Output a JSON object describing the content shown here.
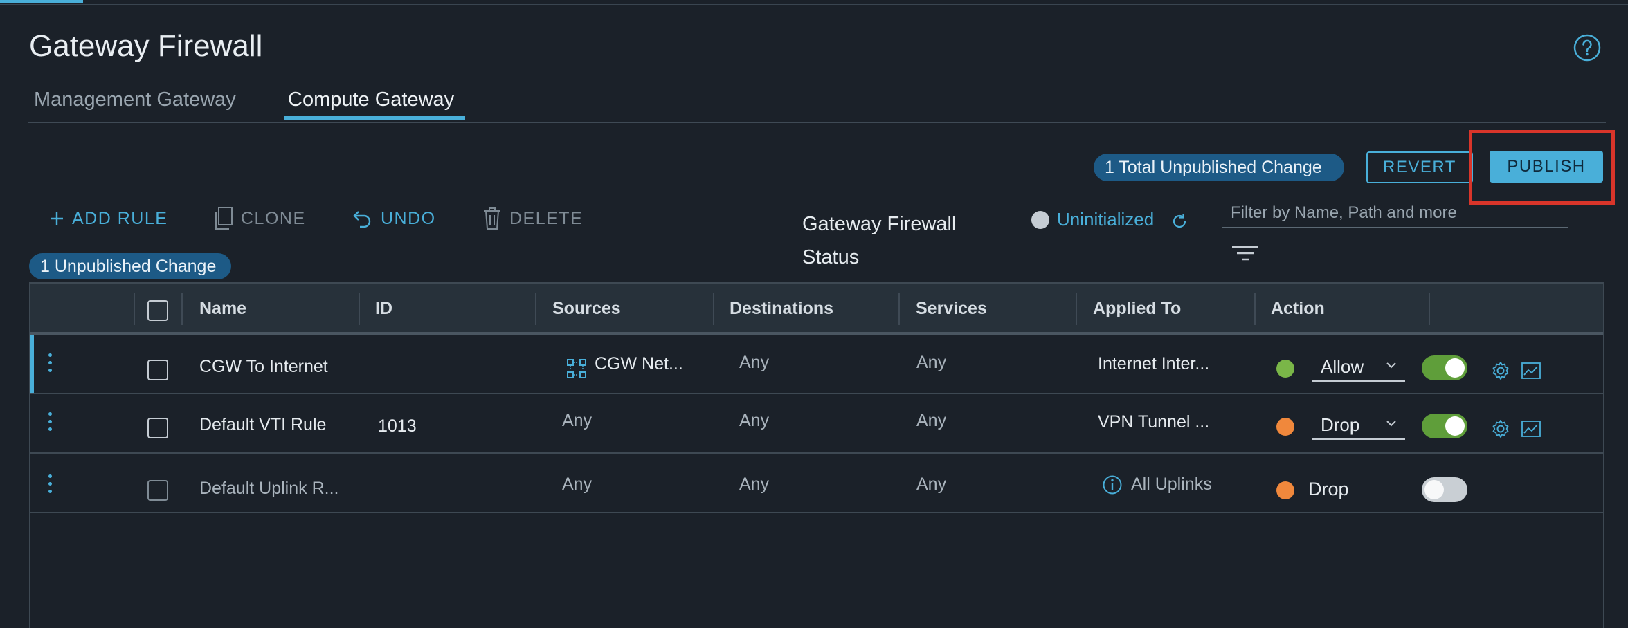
{
  "page": {
    "title": "Gateway Firewall"
  },
  "tabs": [
    {
      "label": "Management Gateway",
      "active": false
    },
    {
      "label": "Compute Gateway",
      "active": true
    }
  ],
  "header_actions": {
    "total_unpublished": "1 Total Unpublished Change",
    "revert": "REVERT",
    "publish": "PUBLISH"
  },
  "toolbar": {
    "add_rule": "ADD RULE",
    "clone": "CLONE",
    "undo": "UNDO",
    "delete": "DELETE"
  },
  "status": {
    "label": "Gateway Firewall Status",
    "value": "Uninitialized"
  },
  "filter": {
    "placeholder": "Filter by Name, Path and more"
  },
  "unpublished_badge": "1 Unpublished Change",
  "table": {
    "columns": [
      "Name",
      "ID",
      "Sources",
      "Destinations",
      "Services",
      "Applied To",
      "Action"
    ],
    "rows": [
      {
        "name": "CGW To Internet",
        "id": "",
        "sources": "CGW Net...",
        "destinations": "Any",
        "services": "Any",
        "applied_to": "Internet Inter...",
        "action": "Allow",
        "status_color": "#7ab648",
        "enabled": true
      },
      {
        "name": "Default VTI Rule",
        "id": "1013",
        "sources": "Any",
        "destinations": "Any",
        "services": "Any",
        "applied_to": "VPN Tunnel ...",
        "action": "Drop",
        "status_color": "#f0883c",
        "enabled": true
      },
      {
        "name": "Default Uplink R...",
        "id": "",
        "sources": "Any",
        "destinations": "Any",
        "services": "Any",
        "applied_to": "All Uplinks",
        "action": "Drop",
        "status_color": "#f0883c",
        "enabled": false
      }
    ]
  },
  "colors": {
    "accent": "#49afd9",
    "allow": "#7ab648",
    "drop": "#f0883c",
    "highlight": "#d9352a"
  },
  "icons": [
    "help-icon",
    "plus-icon",
    "clone-icon",
    "undo-icon",
    "trash-icon",
    "refresh-icon",
    "filter-icon",
    "network-group-icon",
    "info-icon",
    "gear-icon",
    "chart-icon",
    "chevron-down-icon",
    "kebab-icon"
  ]
}
